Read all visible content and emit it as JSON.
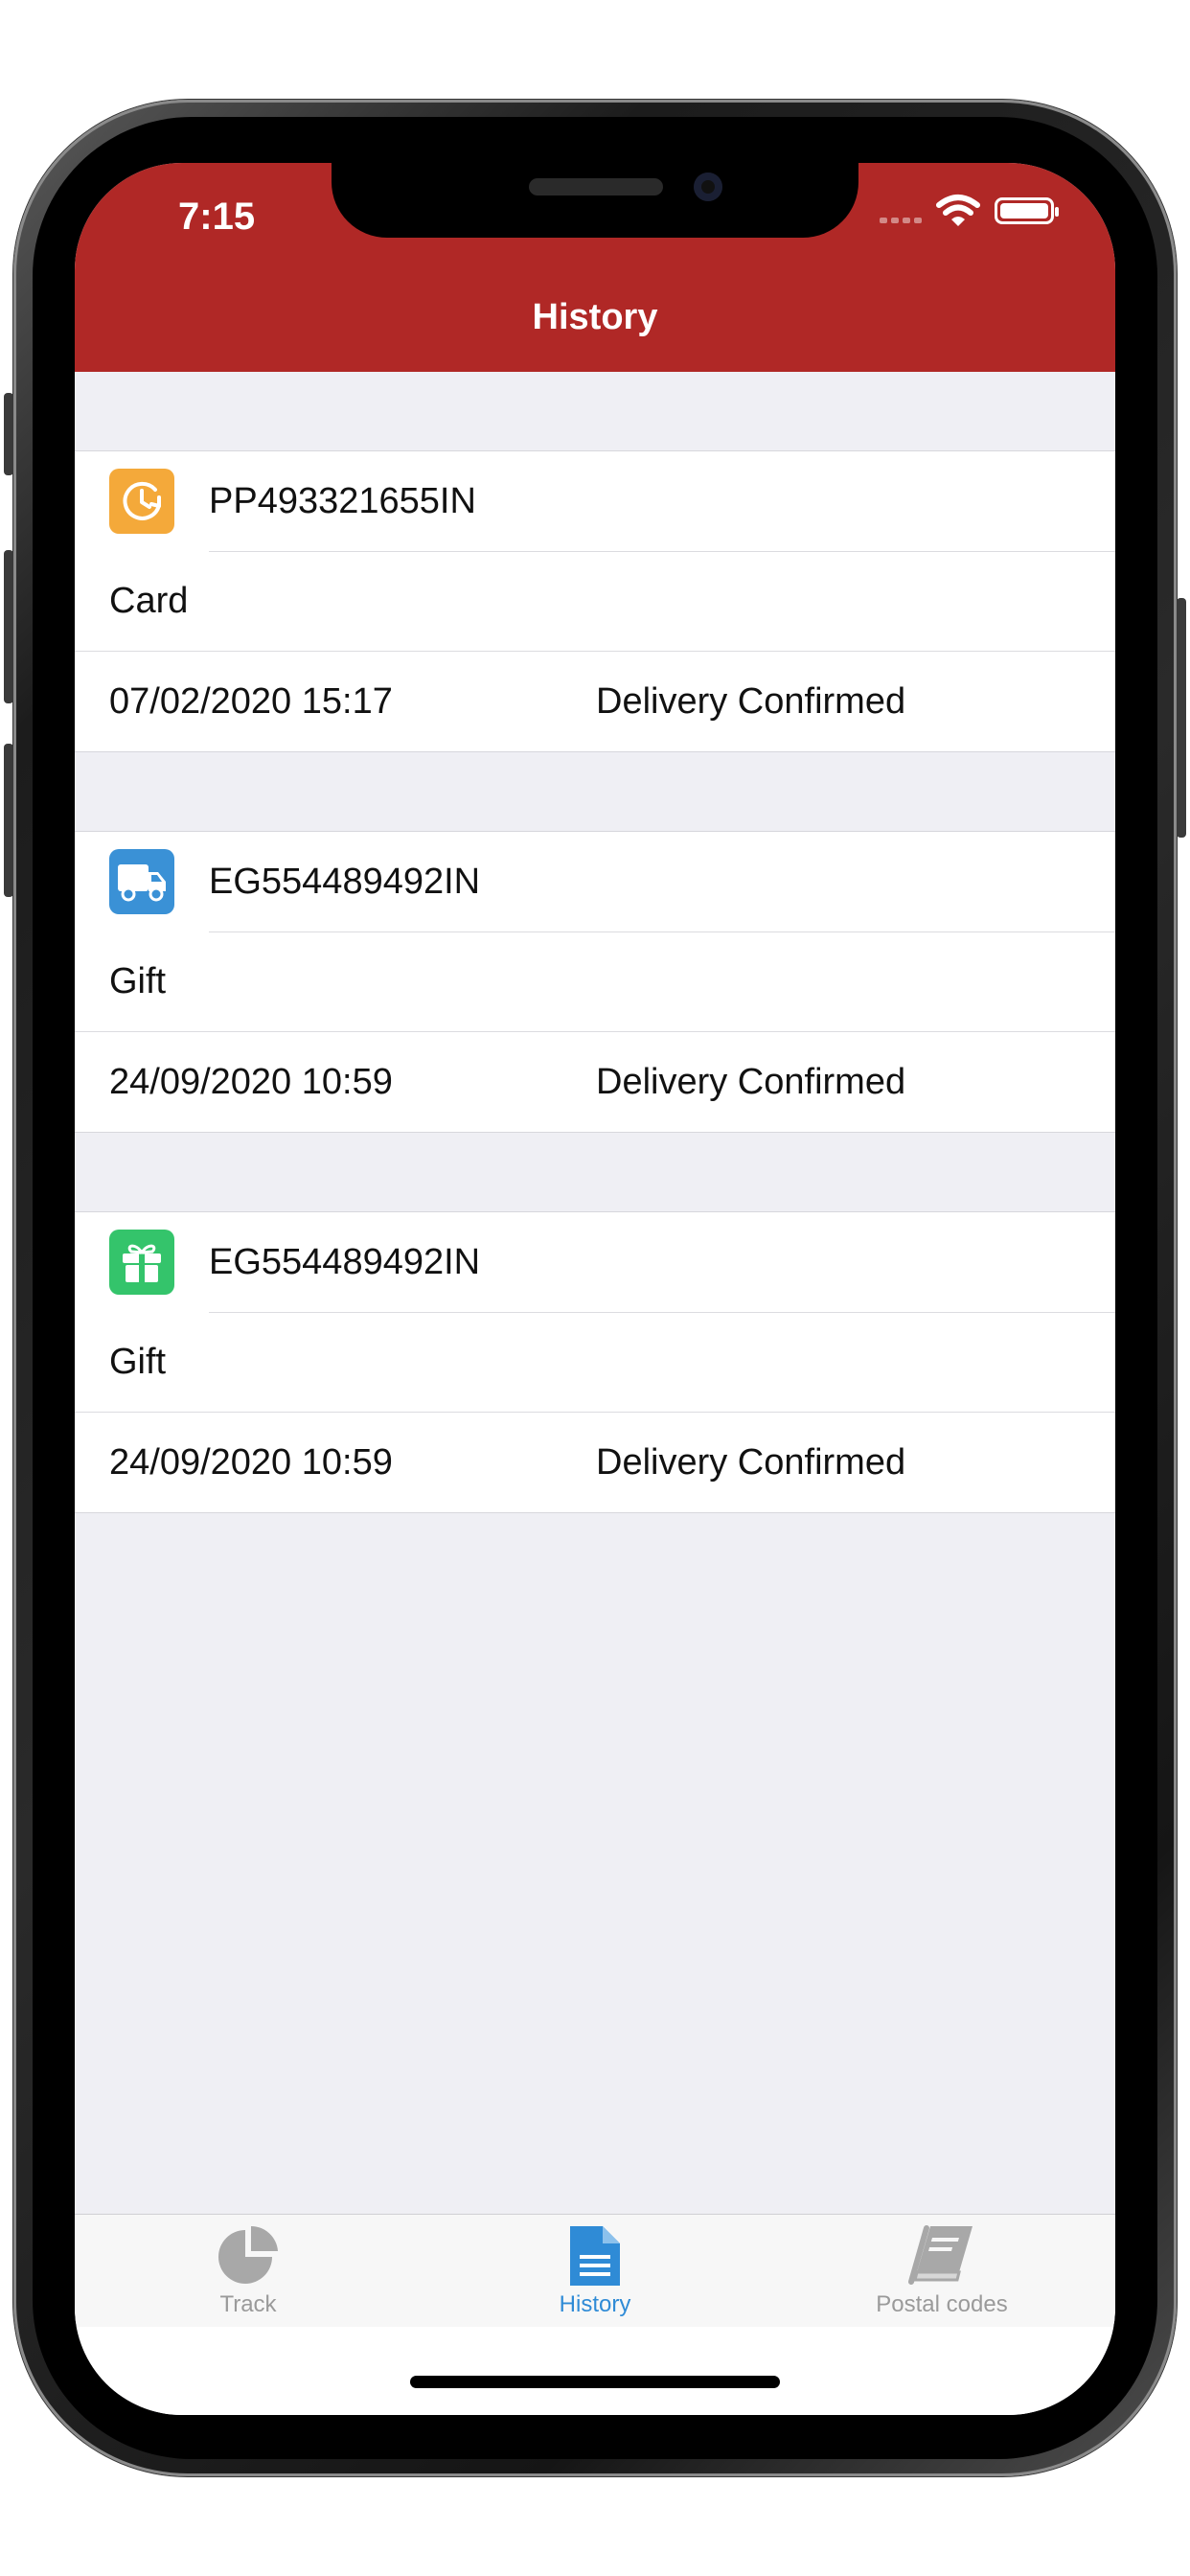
{
  "status_bar": {
    "time": "7:15"
  },
  "nav": {
    "title": "History"
  },
  "history": [
    {
      "icon": "clock-icon",
      "icon_color": "#f4a93a",
      "tracking": "PP493321655IN",
      "description": "Card",
      "datetime": "07/02/2020 15:17",
      "status": "Delivery Confirmed"
    },
    {
      "icon": "truck-icon",
      "icon_color": "#3a91d6",
      "tracking": "EG554489492IN",
      "description": "Gift",
      "datetime": "24/09/2020 10:59",
      "status": "Delivery Confirmed"
    },
    {
      "icon": "gift-icon",
      "icon_color": "#34c46b",
      "tracking": "EG554489492IN",
      "description": "Gift",
      "datetime": "24/09/2020 10:59",
      "status": "Delivery Confirmed"
    }
  ],
  "tabbar": {
    "items": [
      {
        "label": "Track",
        "icon": "pie-chart-icon",
        "active": false
      },
      {
        "label": "History",
        "icon": "document-icon",
        "active": true
      },
      {
        "label": "Postal codes",
        "icon": "book-icon",
        "active": false
      }
    ],
    "active_color": "#2f8bd6",
    "inactive_color": "#9a9a9a"
  },
  "colors": {
    "header": "#b02826",
    "background": "#efeff4"
  }
}
